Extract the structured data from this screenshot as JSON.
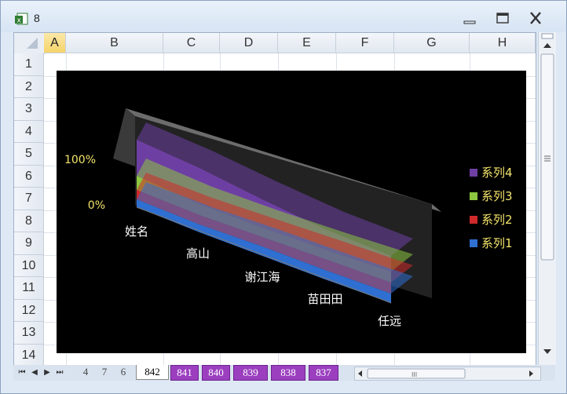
{
  "window": {
    "title": "8"
  },
  "columns": [
    "A",
    "B",
    "C",
    "D",
    "E",
    "F",
    "G",
    "H"
  ],
  "active_column": "A",
  "rows": [
    "1",
    "2",
    "3",
    "4",
    "5",
    "6",
    "7",
    "8",
    "9",
    "10",
    "11",
    "12",
    "13",
    "14"
  ],
  "chart_data": {
    "type": "area",
    "stacking": "percent-3d",
    "categories": [
      "姓名",
      "高山",
      "谢江海",
      "苗田田",
      "任远"
    ],
    "y_tick_labels": [
      "0%",
      "100%"
    ],
    "series": [
      {
        "name": "系列1",
        "color": "#2e6fd1"
      },
      {
        "name": "系列2",
        "color": "#d02a2a"
      },
      {
        "name": "系列3",
        "color": "#8dc63f"
      },
      {
        "name": "系列4",
        "color": "#6e3fa3"
      }
    ],
    "legend_position": "right",
    "background": "#000000"
  },
  "sheet_tabs": [
    "4",
    "7",
    "6",
    "842",
    "841",
    "840",
    "839",
    "838",
    "837"
  ],
  "active_tab": "842",
  "purple_tabs": [
    "841",
    "840",
    "839",
    "838",
    "837"
  ],
  "scroll": {
    "hbar_label": "III"
  }
}
